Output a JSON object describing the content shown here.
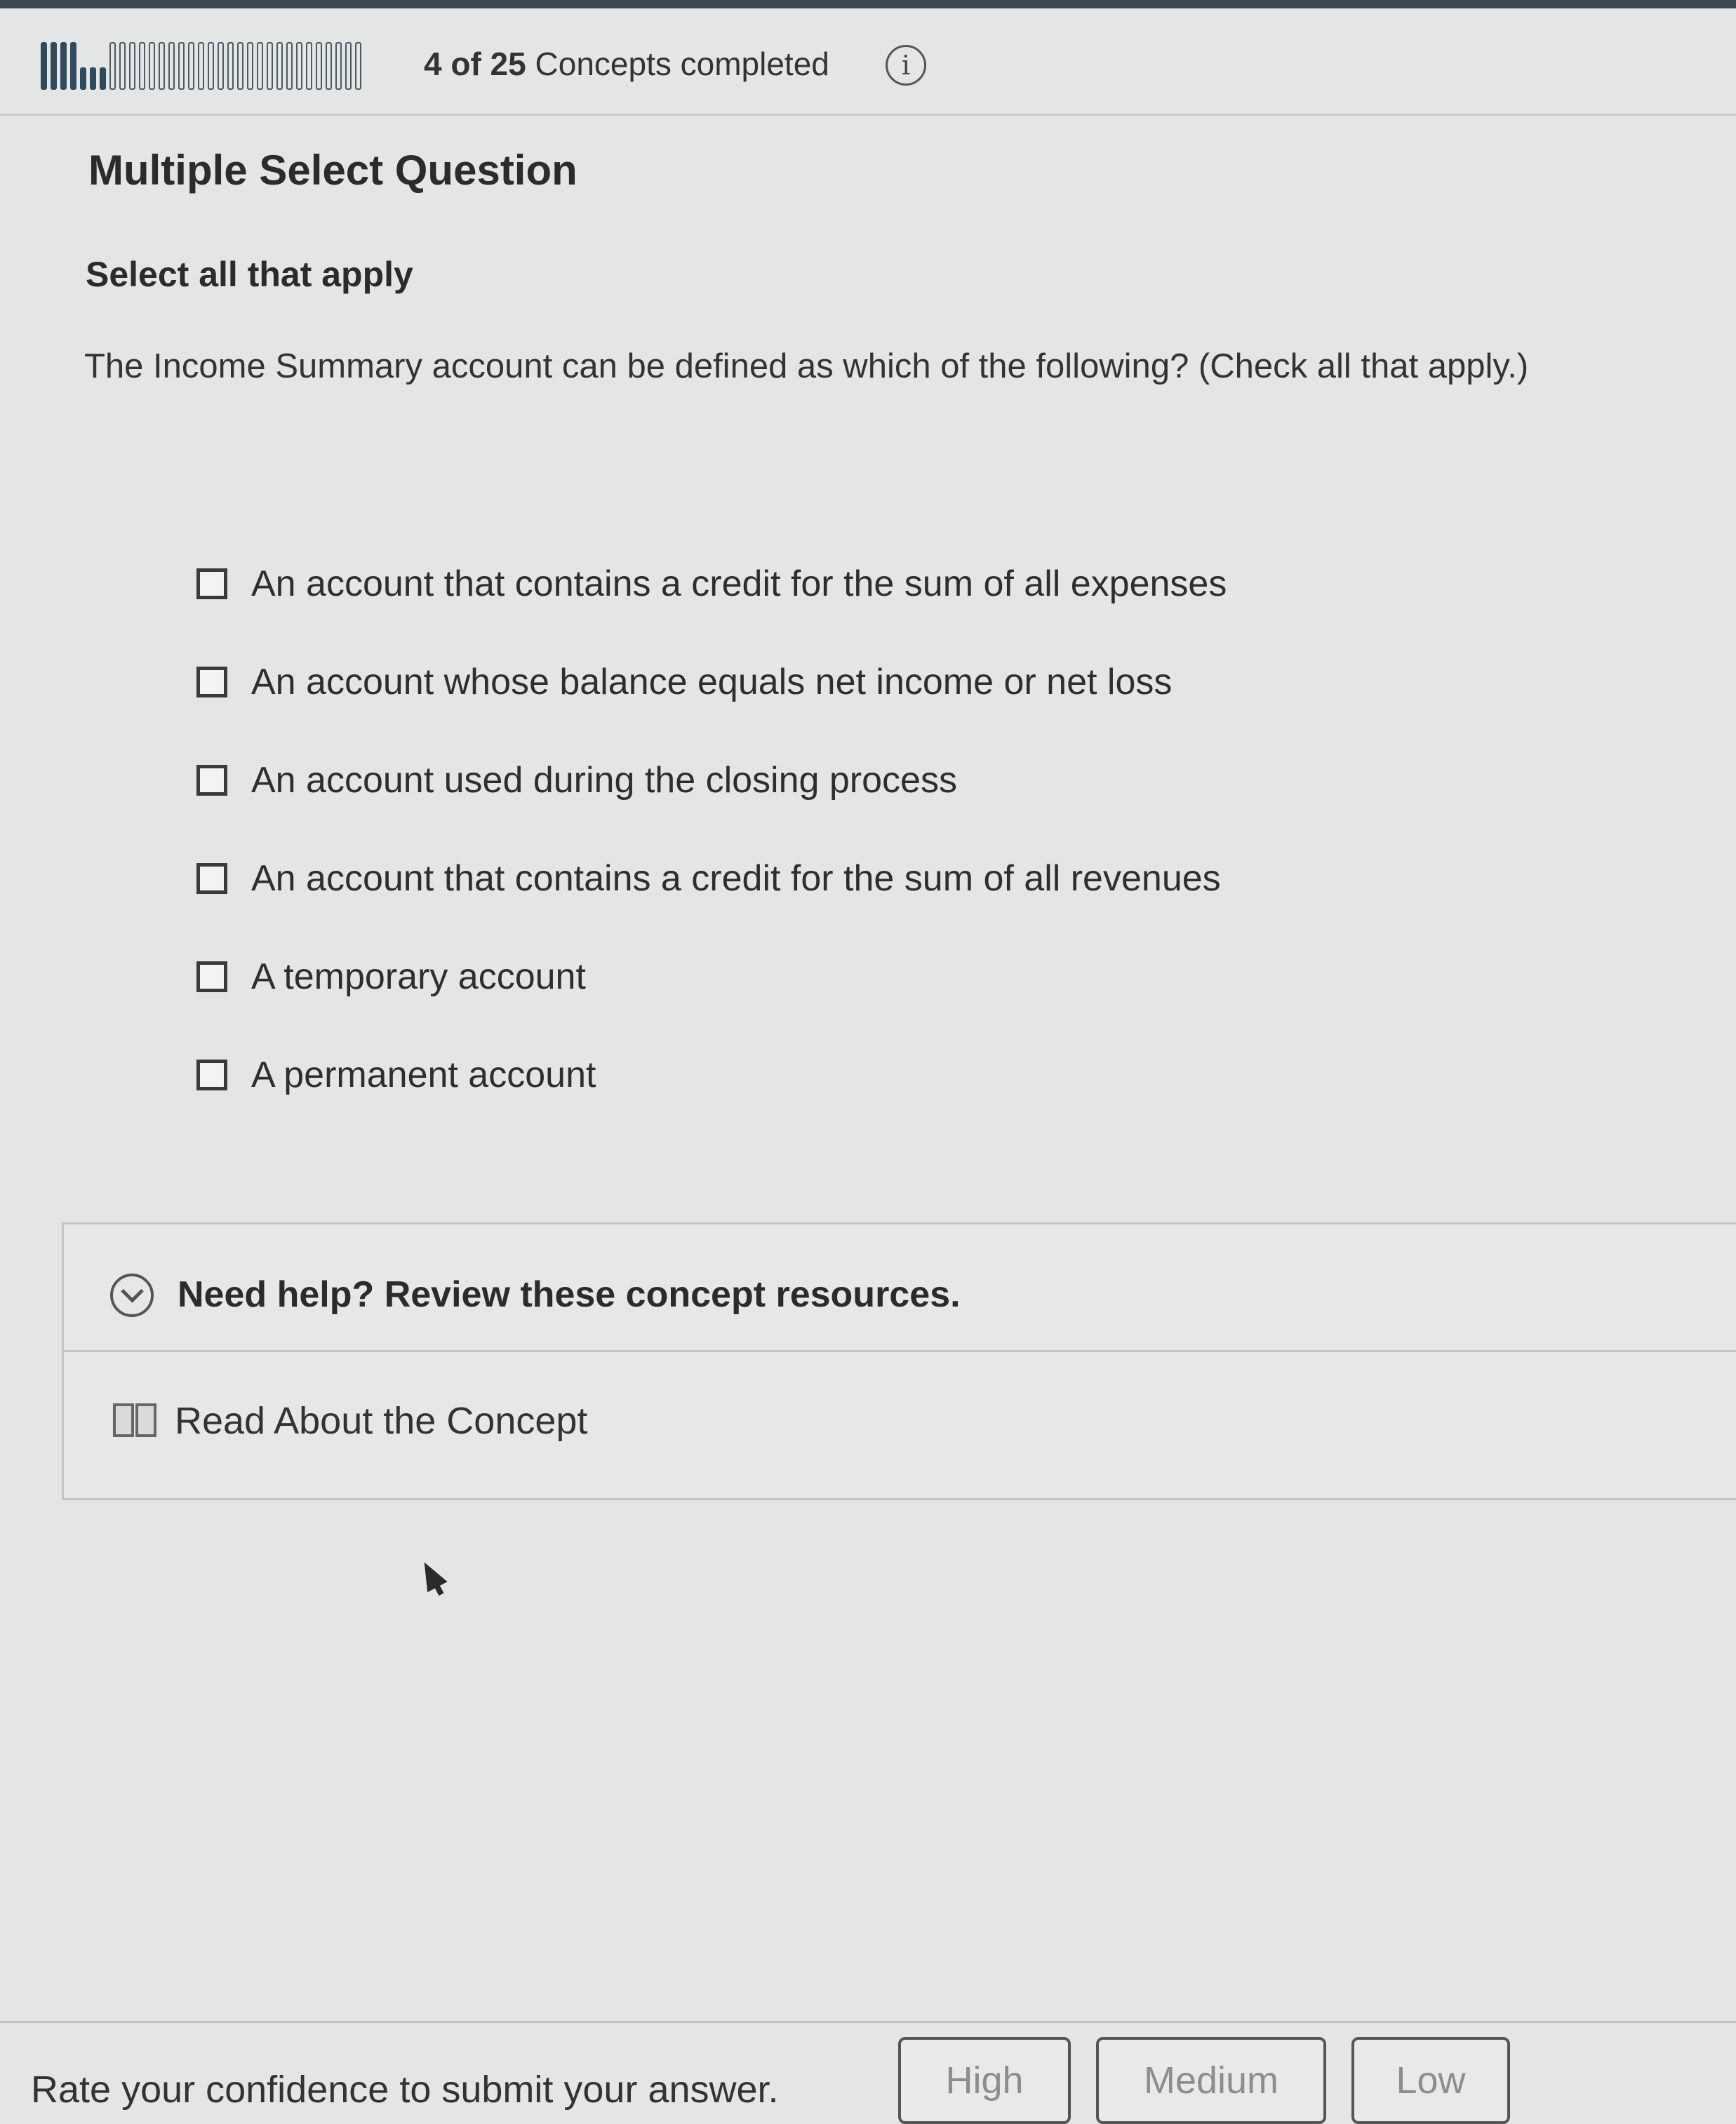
{
  "progress": {
    "completed": 4,
    "total": 25,
    "text_count": "4 of 25",
    "text_suffix": " Concepts completed",
    "info_icon": "info-icon"
  },
  "question": {
    "type_label": "Multiple Select Question",
    "instruction": "Select all that apply",
    "prompt": "The Income Summary account can be defined as which of the following? (Check all that apply.)",
    "options": [
      {
        "label": "An account that contains a credit for the sum of all expenses",
        "checked": false
      },
      {
        "label": "An account whose balance equals net income or net loss",
        "checked": false
      },
      {
        "label": "An account used during the closing process",
        "checked": false
      },
      {
        "label": "An account that contains a credit for the sum of all revenues",
        "checked": false
      },
      {
        "label": "A temporary account",
        "checked": false
      },
      {
        "label": "A permanent account",
        "checked": false
      }
    ]
  },
  "help": {
    "title": "Need help? Review these concept resources.",
    "resource_label": "Read About the Concept",
    "expand_icon": "chevron-down-icon",
    "resource_icon": "book-icon"
  },
  "footer": {
    "confidence_prompt": "Rate your confidence to submit your answer.",
    "buttons": [
      "High",
      "Medium",
      "Low"
    ]
  }
}
